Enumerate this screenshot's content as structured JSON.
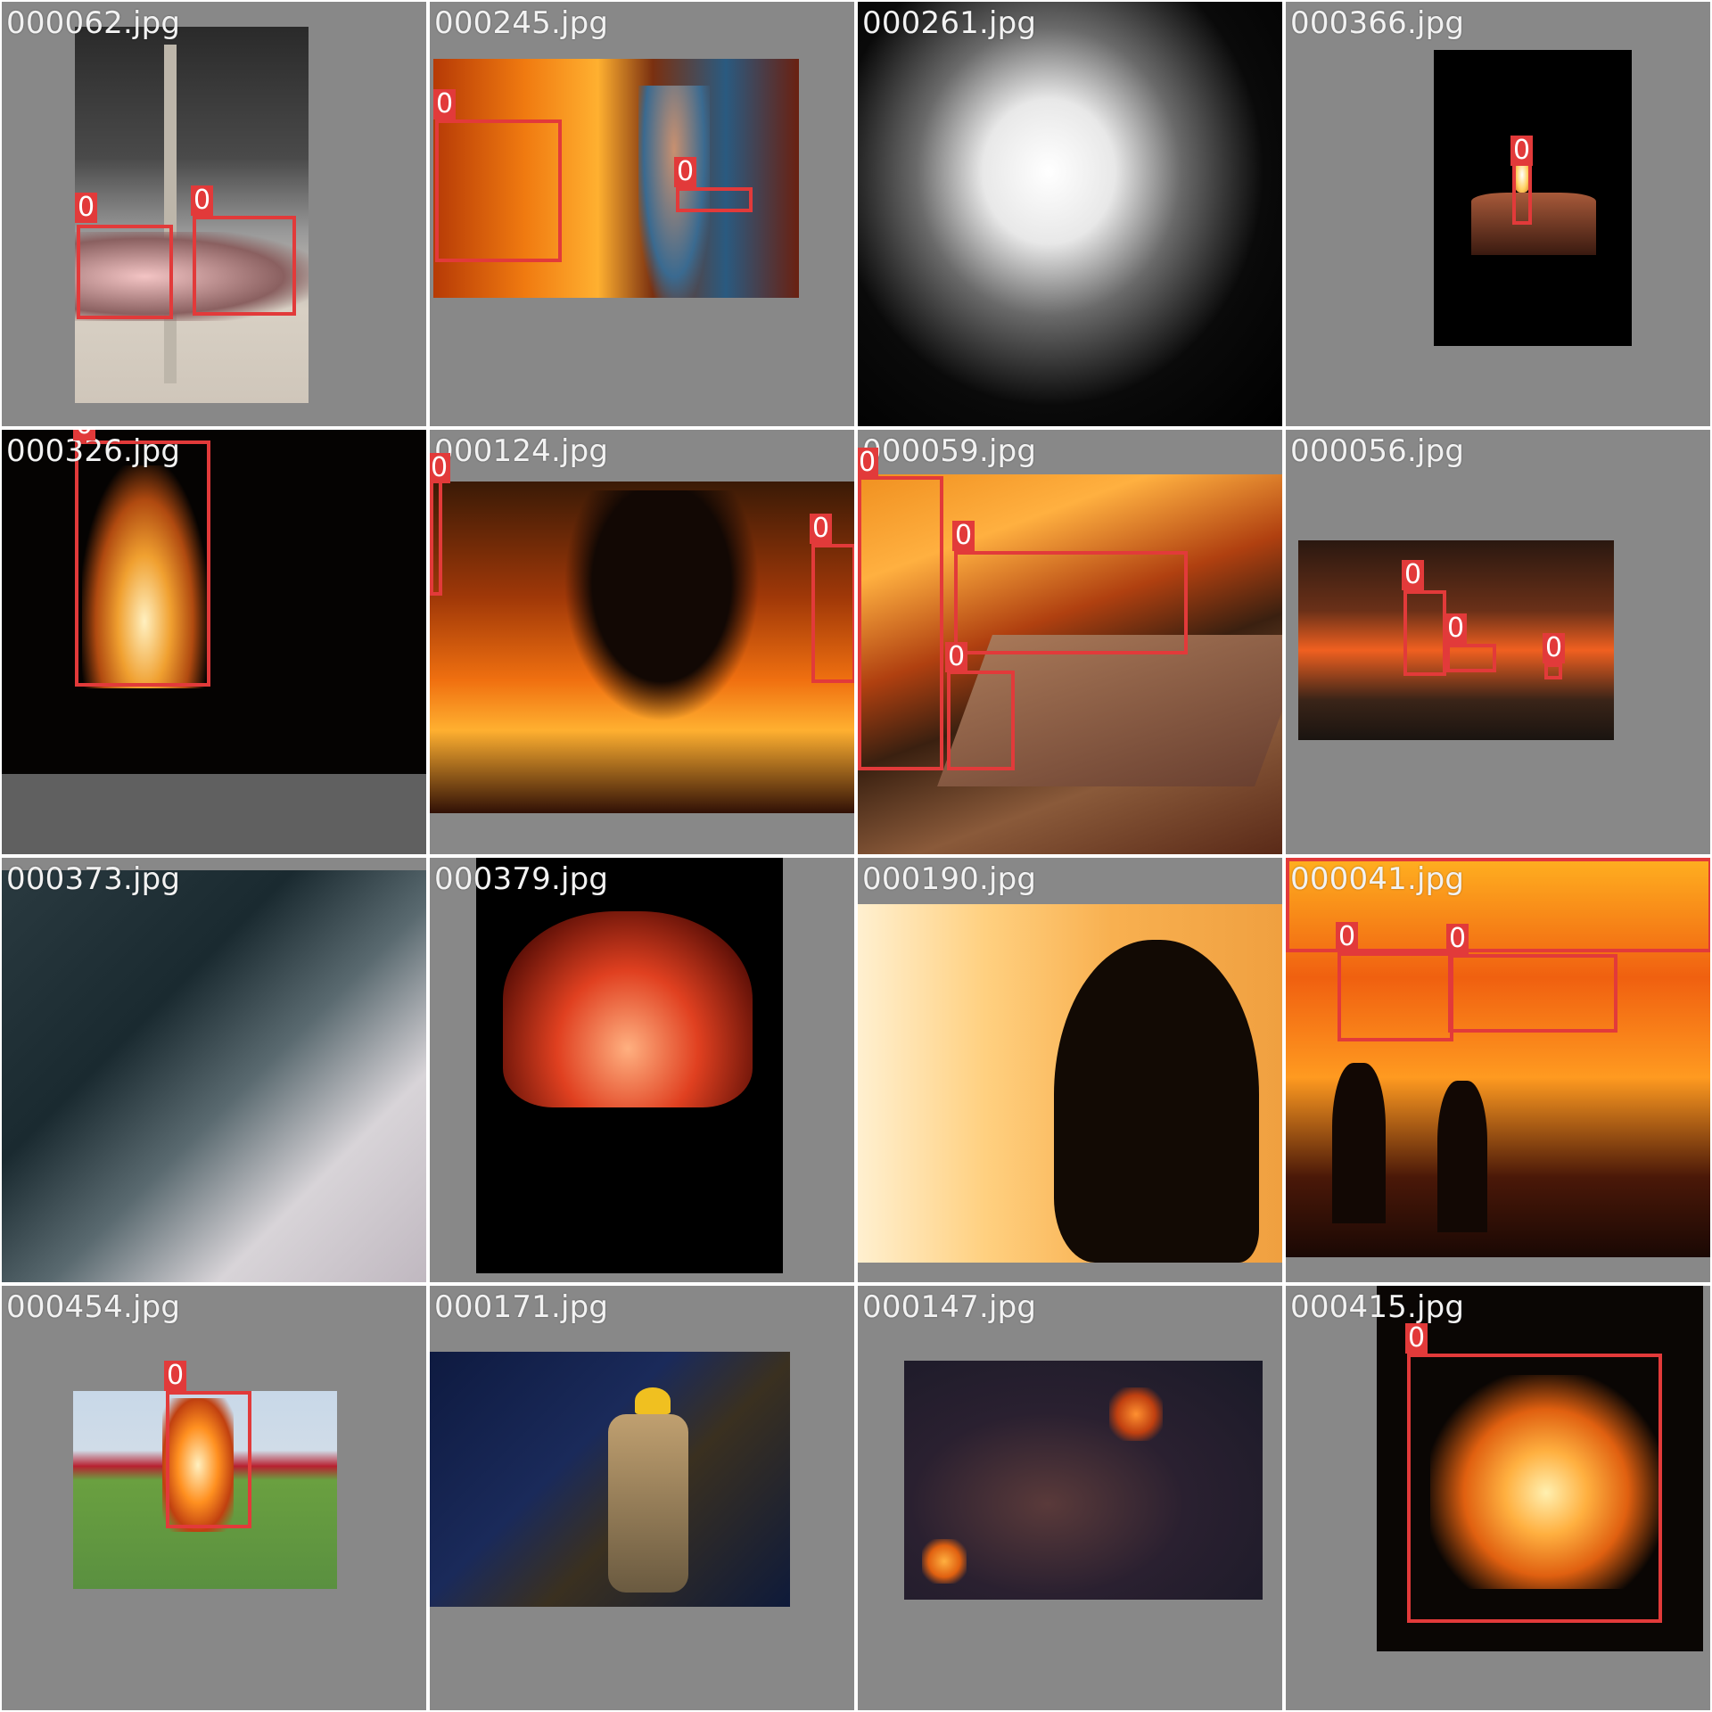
{
  "tiles": [
    {
      "file": "000062.jpg",
      "labels": [
        "0",
        "0"
      ]
    },
    {
      "file": "000245.jpg",
      "labels": [
        "0",
        "0"
      ]
    },
    {
      "file": "000261.jpg",
      "labels": []
    },
    {
      "file": "000366.jpg",
      "labels": [
        "0"
      ]
    },
    {
      "file": "000326.jpg",
      "labels": [
        "0"
      ]
    },
    {
      "file": "000124.jpg",
      "labels": [
        "0",
        "0"
      ]
    },
    {
      "file": "000059.jpg",
      "labels": [
        "0",
        "0",
        "0"
      ]
    },
    {
      "file": "000056.jpg",
      "labels": [
        "0",
        "0",
        "0"
      ]
    },
    {
      "file": "000373.jpg",
      "labels": []
    },
    {
      "file": "000379.jpg",
      "labels": []
    },
    {
      "file": "000190.jpg",
      "labels": []
    },
    {
      "file": "000041.jpg",
      "labels": [
        "0",
        "0",
        "0"
      ]
    },
    {
      "file": "000454.jpg",
      "labels": [
        "0"
      ]
    },
    {
      "file": "000171.jpg",
      "labels": []
    },
    {
      "file": "000147.jpg",
      "labels": []
    },
    {
      "file": "000415.jpg",
      "labels": [
        "0"
      ]
    }
  ],
  "colors": {
    "box": "#e23a3a",
    "tile_bg": "#888888"
  }
}
